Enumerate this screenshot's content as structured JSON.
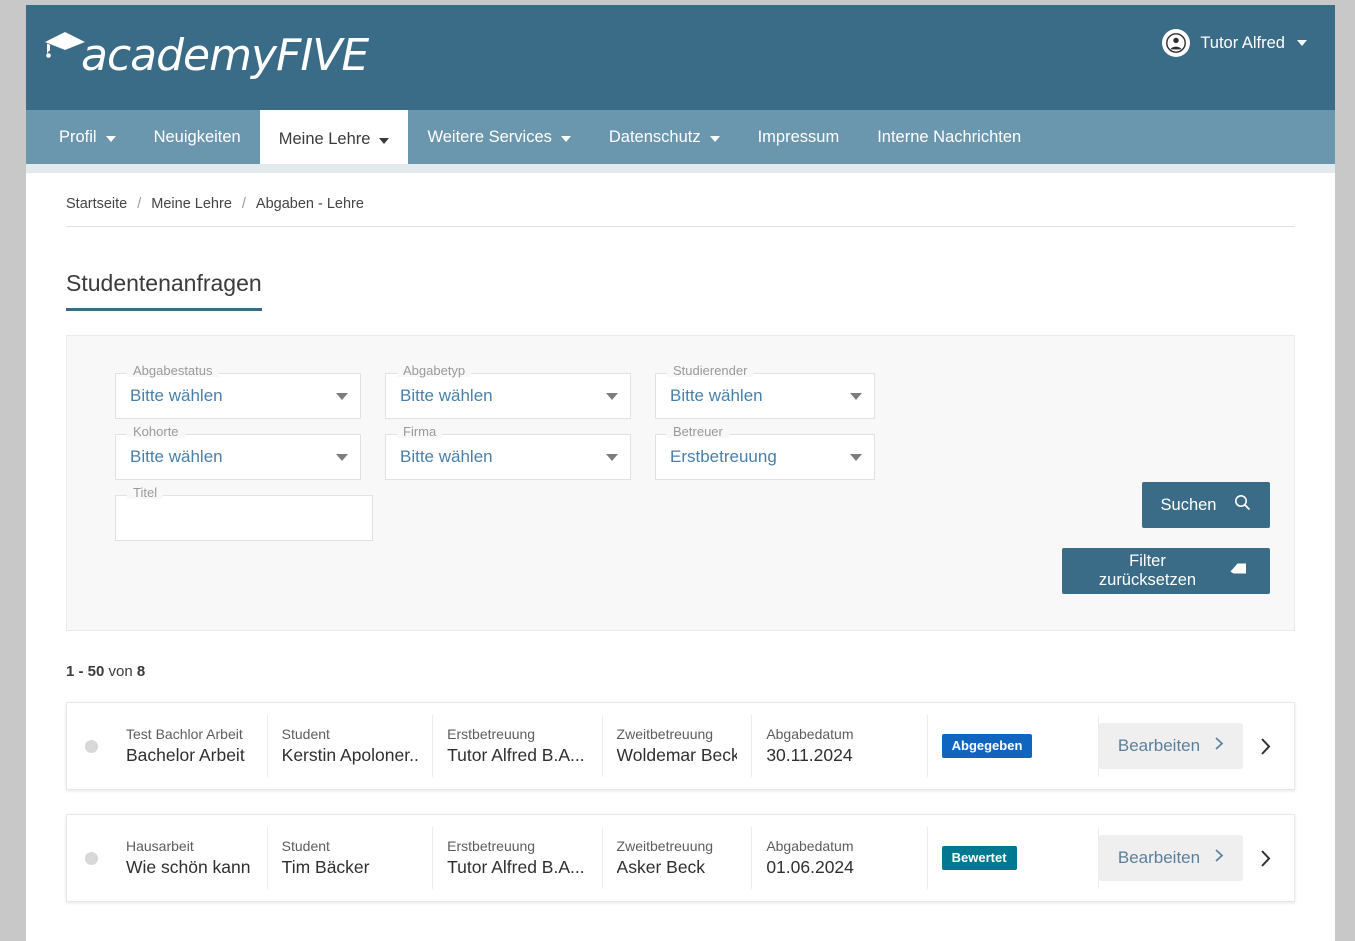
{
  "header": {
    "logo_text": "academyFIVE",
    "logo_icon": "graduation-cap-icon",
    "user_name": "Tutor Alfred",
    "user_icon": "user-avatar-icon"
  },
  "nav": {
    "items": [
      {
        "label": "Profil",
        "has_caret": true,
        "active": false
      },
      {
        "label": "Neuigkeiten",
        "has_caret": false,
        "active": false
      },
      {
        "label": "Meine Lehre",
        "has_caret": true,
        "active": true
      },
      {
        "label": "Weitere Services",
        "has_caret": true,
        "active": false
      },
      {
        "label": "Datenschutz",
        "has_caret": true,
        "active": false
      },
      {
        "label": "Impressum",
        "has_caret": false,
        "active": false
      },
      {
        "label": "Interne Nachrichten",
        "has_caret": false,
        "active": false
      }
    ]
  },
  "breadcrumb": {
    "items": [
      "Startseite",
      "Meine Lehre",
      "Abgaben - Lehre"
    ],
    "separator": "/"
  },
  "page": {
    "title": "Studentenanfragen"
  },
  "filters": {
    "fields": [
      {
        "label": "Abgabestatus",
        "value": "Bitte wählen",
        "type": "select"
      },
      {
        "label": "Abgabetyp",
        "value": "Bitte wählen",
        "type": "select"
      },
      {
        "label": "Studierender",
        "value": "Bitte wählen",
        "type": "select"
      },
      {
        "label": "Kohorte",
        "value": "Bitte wählen",
        "type": "select"
      },
      {
        "label": "Firma",
        "value": "Bitte wählen",
        "type": "select"
      },
      {
        "label": "Betreuer",
        "value": "Erstbetreuung",
        "type": "select"
      }
    ],
    "titel": {
      "label": "Titel",
      "value": "",
      "placeholder": ""
    },
    "search_button": {
      "label": "Suchen",
      "icon": "search-icon"
    },
    "reset_button": {
      "label": "Filter zurücksetzen",
      "icon": "eraser-icon"
    }
  },
  "results": {
    "range": "1 - 50",
    "von": "von",
    "total": "8",
    "rows": [
      {
        "title_label": "Test Bachlor Arbeit",
        "title_value": "Bachelor Arbeit",
        "student_label": "Student",
        "student_value": "Kerstin Apoloner...",
        "erst_label": "Erstbetreuung",
        "erst_value": "Tutor Alfred B.A...",
        "zweit_label": "Zweitbetreuung",
        "zweit_value": "Woldemar Beck",
        "datum_label": "Abgabedatum",
        "datum_value": "30.11.2024",
        "status": "Abgegeben",
        "status_kind": "abgegeben",
        "edit_label": "Bearbeiten"
      },
      {
        "title_label": "Hausarbeit",
        "title_value": "Wie schön kann S",
        "student_label": "Student",
        "student_value": "Tim Bäcker",
        "erst_label": "Erstbetreuung",
        "erst_value": "Tutor Alfred B.A...",
        "zweit_label": "Zweitbetreuung",
        "zweit_value": "Asker Beck",
        "datum_label": "Abgabedatum",
        "datum_value": "01.06.2024",
        "status": "Bewertet",
        "status_kind": "bewertet",
        "edit_label": "Bearbeiten"
      }
    ]
  },
  "colors": {
    "header_blue": "#3a6c87",
    "nav_blue": "#6b97ae",
    "badge_abgegeben": "#1065c0",
    "badge_bewertet": "#00788f",
    "link_blue": "#4a7fa8"
  }
}
